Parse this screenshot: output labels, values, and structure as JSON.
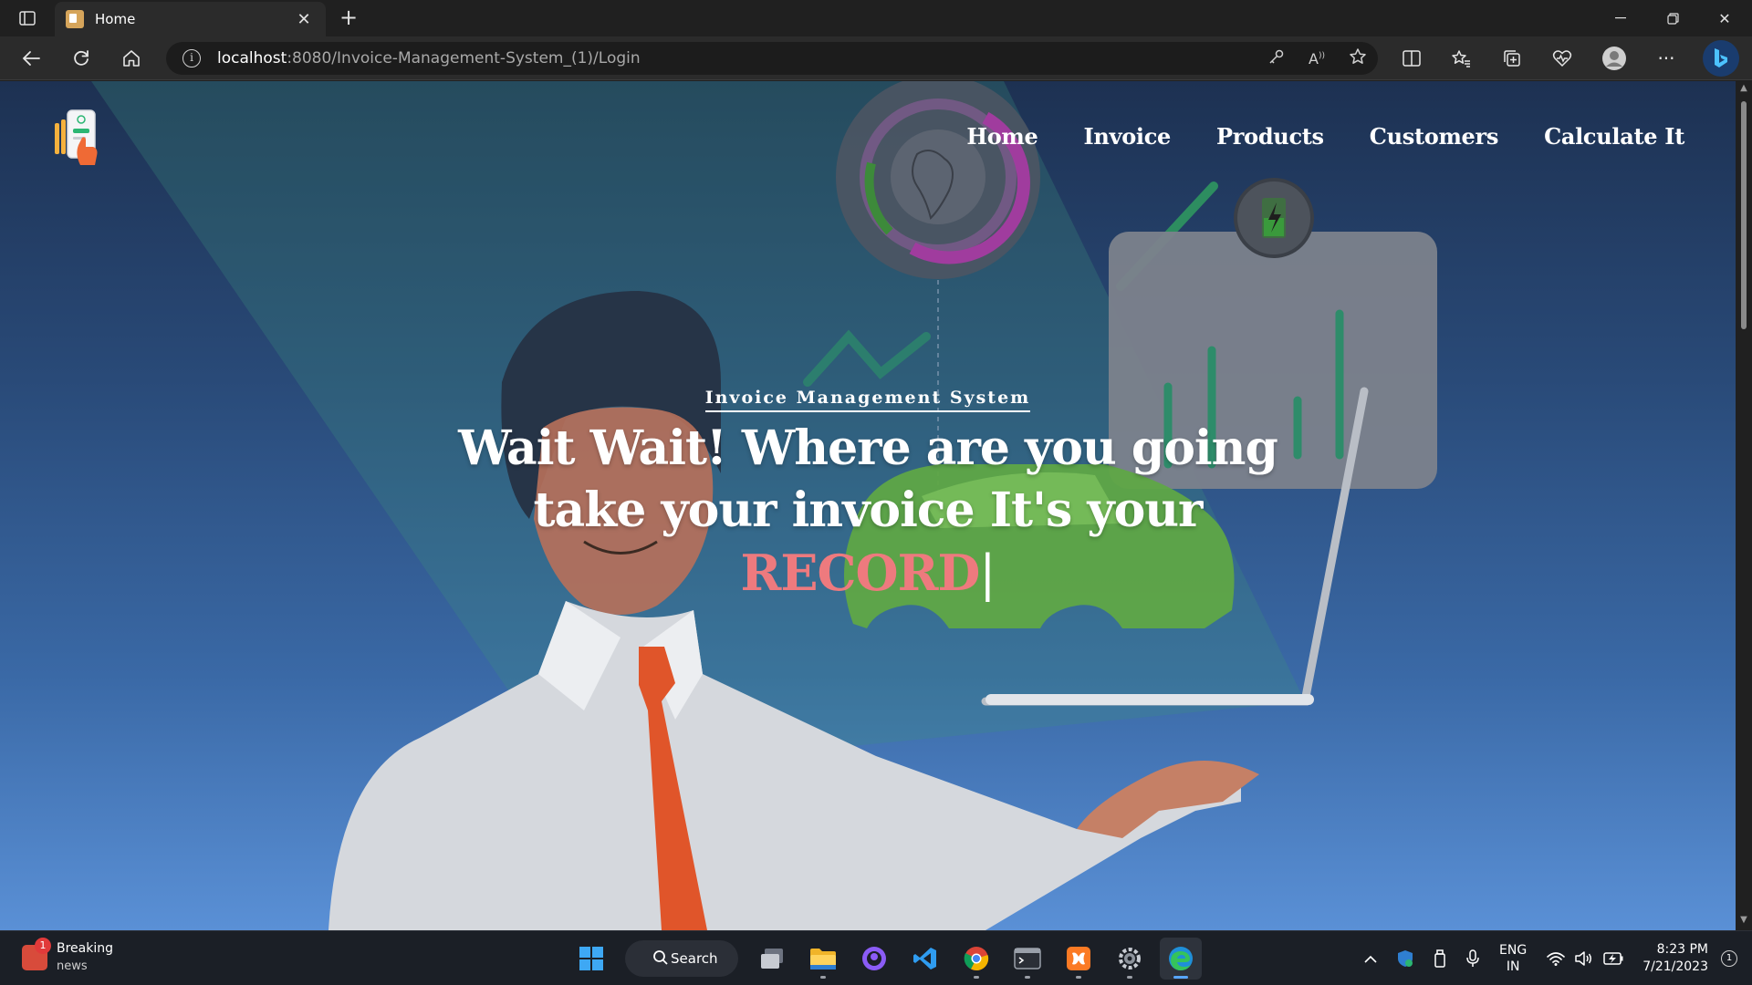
{
  "browser": {
    "tab": {
      "title": "Home"
    },
    "new_tab": "+",
    "address": {
      "host": "localhost",
      "rest": ":8080/Invoice-Management-System_(1)/Login"
    }
  },
  "site": {
    "nav": [
      {
        "label": "Home"
      },
      {
        "label": "Invoice"
      },
      {
        "label": "Products"
      },
      {
        "label": "Customers"
      },
      {
        "label": "Calculate It"
      }
    ],
    "hero": {
      "kicker": "Invoice Management System",
      "line1": "Wait Wait! Where are you going",
      "line2": "take your invoice It's your",
      "typed": "RECORD",
      "caret": "|"
    },
    "colors": {
      "accent": "#ee7a7e",
      "bg_top": "#1d3152",
      "bg_bottom": "#5a90d6"
    }
  },
  "taskbar": {
    "news": {
      "title": "Breaking",
      "subtitle": "news",
      "badge": "1"
    },
    "search_label": "Search",
    "lang": {
      "line1": "ENG",
      "line2": "IN"
    },
    "clock": {
      "time": "8:23 PM",
      "date": "7/21/2023"
    },
    "notifications": "1"
  }
}
